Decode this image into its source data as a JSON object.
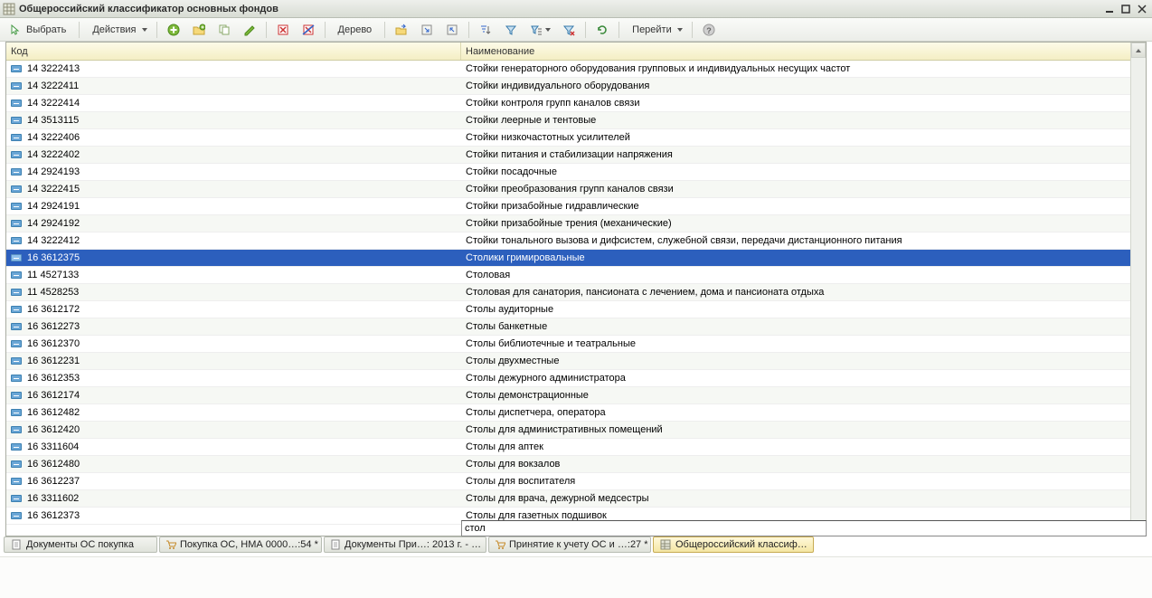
{
  "window": {
    "title": "Общероссийский классификатор основных фондов"
  },
  "toolbar": {
    "select_label": "Выбрать",
    "actions_label": "Действия",
    "tree_label": "Дерево",
    "goto_label": "Перейти"
  },
  "table": {
    "headers": {
      "code": "Код",
      "name": "Наименование"
    },
    "search_value": "стол",
    "rows": [
      {
        "code": "14 3222413",
        "name": "Стойки генераторного оборудования групповых и индивидуальных несущих частот"
      },
      {
        "code": "14 3222411",
        "name": "Стойки индивидуального оборудования"
      },
      {
        "code": "14 3222414",
        "name": "Стойки контроля групп каналов связи"
      },
      {
        "code": "14 3513115",
        "name": "Стойки леерные и тентовые"
      },
      {
        "code": "14 3222406",
        "name": "Стойки низкочастотных усилителей"
      },
      {
        "code": "14 3222402",
        "name": "Стойки питания и стабилизации напряжения"
      },
      {
        "code": "14 2924193",
        "name": "Стойки посадочные"
      },
      {
        "code": "14 3222415",
        "name": "Стойки преобразования групп каналов связи"
      },
      {
        "code": "14 2924191",
        "name": "Стойки призабойные гидравлические"
      },
      {
        "code": "14 2924192",
        "name": "Стойки призабойные трения (механические)"
      },
      {
        "code": "14 3222412",
        "name": "Стойки тонального вызова и дифсистем, служебной связи, передачи дистанционного питания"
      },
      {
        "code": "16 3612375",
        "name": "Столики гримировальные",
        "selected": true
      },
      {
        "code": "11 4527133",
        "name": "Столовая"
      },
      {
        "code": "11 4528253",
        "name": "Столовая для санатория, пансионата с лечением, дома и пансионата отдыха"
      },
      {
        "code": "16 3612172",
        "name": "Столы аудиторные"
      },
      {
        "code": "16 3612273",
        "name": "Столы банкетные"
      },
      {
        "code": "16 3612370",
        "name": "Столы библиотечные и театральные"
      },
      {
        "code": "16 3612231",
        "name": "Столы двухместные"
      },
      {
        "code": "16 3612353",
        "name": "Столы дежурного администратора"
      },
      {
        "code": "16 3612174",
        "name": "Столы демонстрационные"
      },
      {
        "code": "16 3612482",
        "name": "Столы диспетчера, оператора"
      },
      {
        "code": "16 3612420",
        "name": "Столы для административных помещений"
      },
      {
        "code": "16 3311604",
        "name": "Столы для аптек"
      },
      {
        "code": "16 3612480",
        "name": "Столы для вокзалов"
      },
      {
        "code": "16 3612237",
        "name": "Столы для воспитателя"
      },
      {
        "code": "16 3311602",
        "name": "Столы для врача, дежурной медсестры"
      },
      {
        "code": "16 3612373",
        "name": "Столы для газетных подшивок"
      }
    ]
  },
  "tabs": [
    {
      "label": "Документы ОС покупка",
      "icon": "doc"
    },
    {
      "label": "Покупка ОС, НМА 0000…:54 *",
      "icon": "cart"
    },
    {
      "label": "Документы При…: 2013 г. - …",
      "icon": "doc"
    },
    {
      "label": "Принятие к учету ОС и …:27 *",
      "icon": "cart"
    },
    {
      "label": "Общероссийский классиф…",
      "icon": "grid",
      "active": true
    }
  ]
}
